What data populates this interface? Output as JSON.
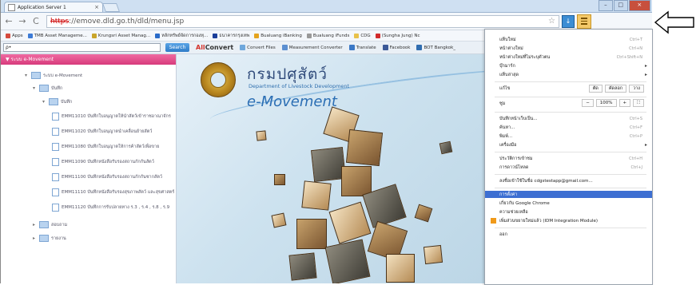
{
  "window": {
    "tab_title": "Application Server 1",
    "tab_close": "×",
    "controls": {
      "minimize": "–",
      "maximize": "□",
      "close": "×"
    }
  },
  "nav": {
    "back": "←",
    "forward": "→",
    "reload": "C",
    "url_scheme": "https",
    "url_rest": "://emove.dld.go.th/dld/menu.jsp",
    "star": "☆"
  },
  "bookmarks": [
    {
      "label": "Apps",
      "color": "#d64b3d"
    },
    {
      "label": "TMB Asset Manageme...",
      "color": "#3d7bd6"
    },
    {
      "label": "Krungsri Asset Manag...",
      "color": "#c9a52a"
    },
    {
      "label": "หลักทรัพย์จัดการกองทุ...",
      "color": "#2a6bc9"
    },
    {
      "label": "ธนาคารกรุงเทพ",
      "color": "#1c3f9a"
    },
    {
      "label": "Bualuang iBanking",
      "color": "#e4a31e"
    },
    {
      "label": "Bualuang iFunds",
      "color": "#999999"
    },
    {
      "label": "CDG",
      "color": "#e8c14a"
    },
    {
      "label": "(Sungha Jung) Nc",
      "color": "#d12b2b"
    }
  ],
  "toolbar": {
    "search_placeholder": "ρ•",
    "search_button": "Search",
    "logo_prefix": "All",
    "logo_main": "Convert",
    "items": [
      {
        "label": "Convert Files",
        "color": "#6fa8dc"
      },
      {
        "label": "Measurement Converter",
        "color": "#5b8fd1"
      },
      {
        "label": "Translate",
        "color": "#3b78c6"
      },
      {
        "label": "Facebook",
        "color": "#3b5998"
      },
      {
        "label": "BOT Bangkok_",
        "color": "#2f6db0"
      }
    ]
  },
  "left": {
    "header": "▼ ระบบ e-Movement",
    "root": "ระบบ e-Movement",
    "folder1": "บันทึก",
    "folder2": "บันทึก",
    "docs": [
      "EMM11010  บันทึกใบอนุญาตให้นำสัตว์เข้าราชอาณาจักร",
      "EMM11020  บันทึกใบอนุญาตนำเคลื่อนย้ายสัตว์",
      "EMM11080  บันทึกใบอนุญาตให้การค้าสัตว์เพื่อขาย",
      "EMM11090  บันทึกหนังสือรับรองสถานกักกันสัตว์",
      "EMM11100  บันทึกหนังสือรับรองสถานกักกันซากสัตว์",
      "EMM11110  บันทึกหนังสือรับรองสุขภาพสัตว์ และสุขศาสตร์",
      "EMM11120  บันทึกการรับปลายทาง ร.3 , ร.4 , ร.8 , ร.9"
    ],
    "folder3": "สอบถาม",
    "folder4": "รายงาน"
  },
  "brand": {
    "thai": "กรมปศุสัตว์",
    "english": "Department of Livestock Development",
    "app": "e-Movement"
  },
  "menu": {
    "items": [
      {
        "label": "แท็บใหม่",
        "shortcut": "Ctrl+T"
      },
      {
        "label": "หน้าต่างใหม่",
        "shortcut": "Ctrl+N"
      },
      {
        "label": "หน้าต่างใหม่ที่ไม่ระบุตัวตน",
        "shortcut": "Ctrl+Shift+N"
      },
      {
        "label": "บุ๊กมาร์ก",
        "shortcut": "▸"
      },
      {
        "label": "แท็บล่าสุด",
        "shortcut": "▸"
      }
    ],
    "edit_label": "แก้ไข",
    "cut": "ตัด",
    "copy": "คัดลอก",
    "paste": "วาง",
    "zoom_label": "ซูม",
    "zoom_minus": "−",
    "zoom_value": "100%",
    "zoom_plus": "+",
    "zoom_full": "⛶",
    "items2": [
      {
        "label": "บันทึกหน้าเว็บเป็น...",
        "shortcut": "Ctrl+S"
      },
      {
        "label": "ค้นหา...",
        "shortcut": "Ctrl+F"
      },
      {
        "label": "พิมพ์...",
        "shortcut": "Ctrl+P"
      },
      {
        "label": "เครื่องมือ",
        "shortcut": "▸"
      }
    ],
    "items3": [
      {
        "label": "ประวัติการเข้าชม",
        "shortcut": "Ctrl+H"
      },
      {
        "label": "การดาวน์โหลด",
        "shortcut": "Ctrl+J"
      }
    ],
    "signin": "ลงชื่อเข้าใช้ในชื่อ cdgstestapp@gmail.com...",
    "items4": [
      {
        "label": "การตั้งค่า",
        "shortcut": ""
      },
      {
        "label": "เกี่ยวกับ Google Chrome",
        "shortcut": ""
      },
      {
        "label": "ความช่วยเหลือ",
        "shortcut": ""
      },
      {
        "label": "เพิ่มส่วนขยายใหม่แล้ว (IDM Integration Module)",
        "shortcut": ""
      }
    ],
    "exit": "ออก",
    "highlight_color": "#3d6fd2"
  }
}
